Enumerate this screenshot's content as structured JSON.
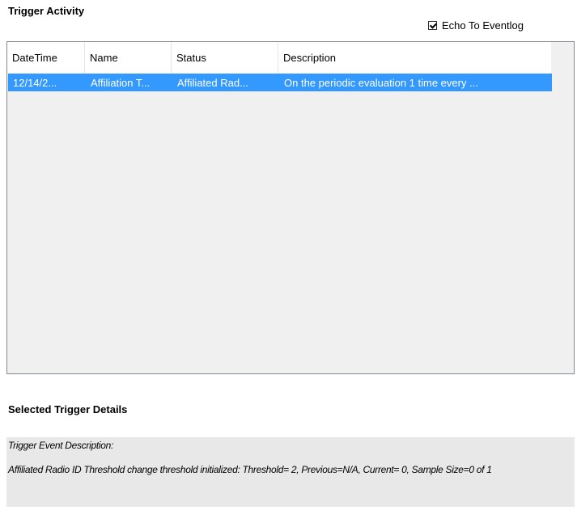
{
  "trigger_activity": {
    "title": "Trigger Activity",
    "echo_checkbox": {
      "label": "Echo To Eventlog",
      "checked": true
    },
    "columns": [
      "DateTime",
      "Name",
      "Status",
      "Description"
    ],
    "rows": [
      {
        "datetime": "12/14/2...",
        "name": "Affiliation T...",
        "status": "Affiliated Rad...",
        "description": "On the periodic evaluation 1 time every ...",
        "selected": true
      }
    ]
  },
  "selected_details": {
    "title": "Selected Trigger Details",
    "label": "Trigger Event Description:",
    "description": "Affiliated Radio ID Threshold change threshold initialized: Threshold= 2, Previous=N/A, Current= 0, Sample Size=0 of 1"
  },
  "colors": {
    "selection": "#3399ff",
    "panel": "#f0f0f0",
    "details_bg": "#e8e8e8"
  }
}
